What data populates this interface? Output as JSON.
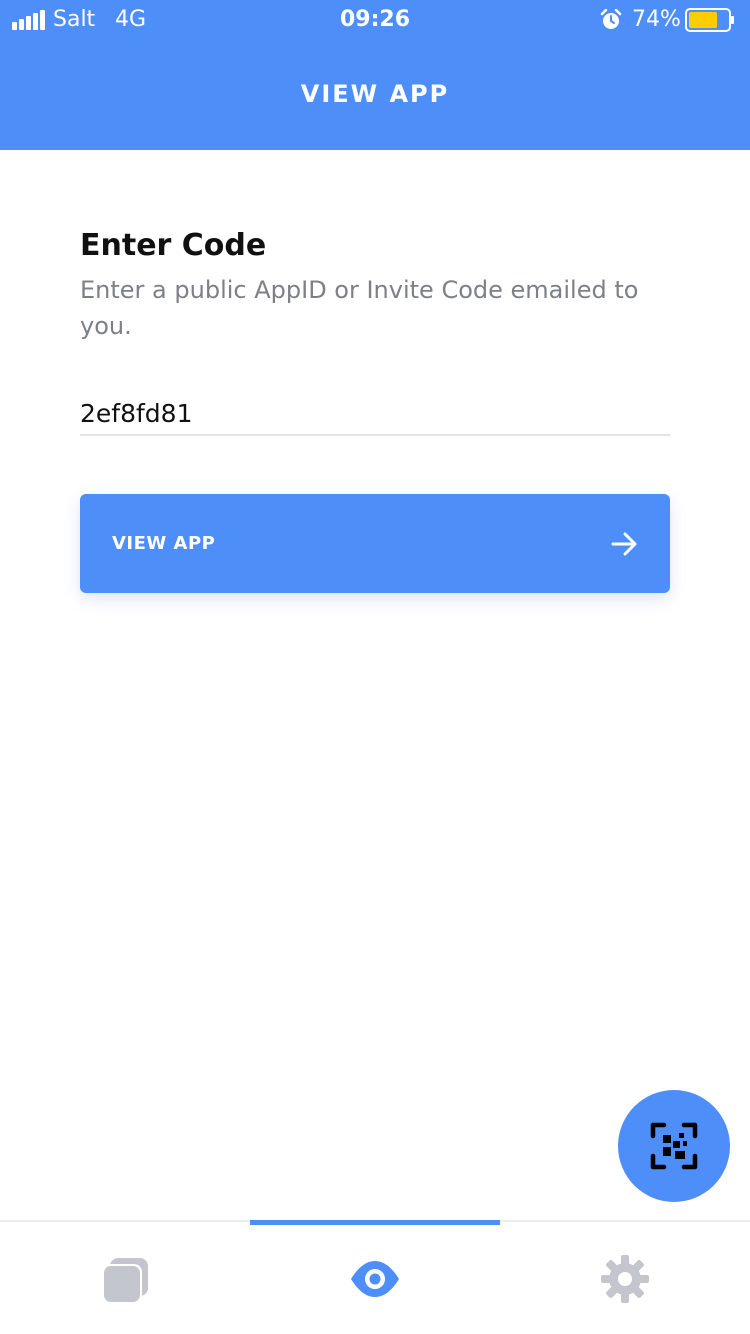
{
  "status_bar": {
    "carrier": "Salt",
    "network": "4G",
    "time": "09:26",
    "battery_percent": "74%",
    "battery_level": 0.74,
    "icons": [
      "signal-icon",
      "alarm-icon",
      "battery-icon"
    ]
  },
  "nav": {
    "title": "VIEW APP"
  },
  "form": {
    "title": "Enter Code",
    "subtitle": "Enter a public AppID or Invite Code emailed to you.",
    "code_value": "2ef8fd81",
    "button_label": "VIEW APP",
    "button_icon": "arrow-right-icon"
  },
  "fab": {
    "icon": "qr-scan-icon"
  },
  "tab_bar": {
    "tabs": [
      {
        "icon": "apps-stack-icon",
        "selected": false
      },
      {
        "icon": "eye-icon",
        "selected": true
      },
      {
        "icon": "gear-icon",
        "selected": false
      }
    ]
  },
  "colors": {
    "accent": "#4d8ef8",
    "text_primary": "#111111",
    "text_secondary": "#7c8189",
    "tab_inactive": "#c3c6cc",
    "battery_fill": "#ffcc00"
  }
}
